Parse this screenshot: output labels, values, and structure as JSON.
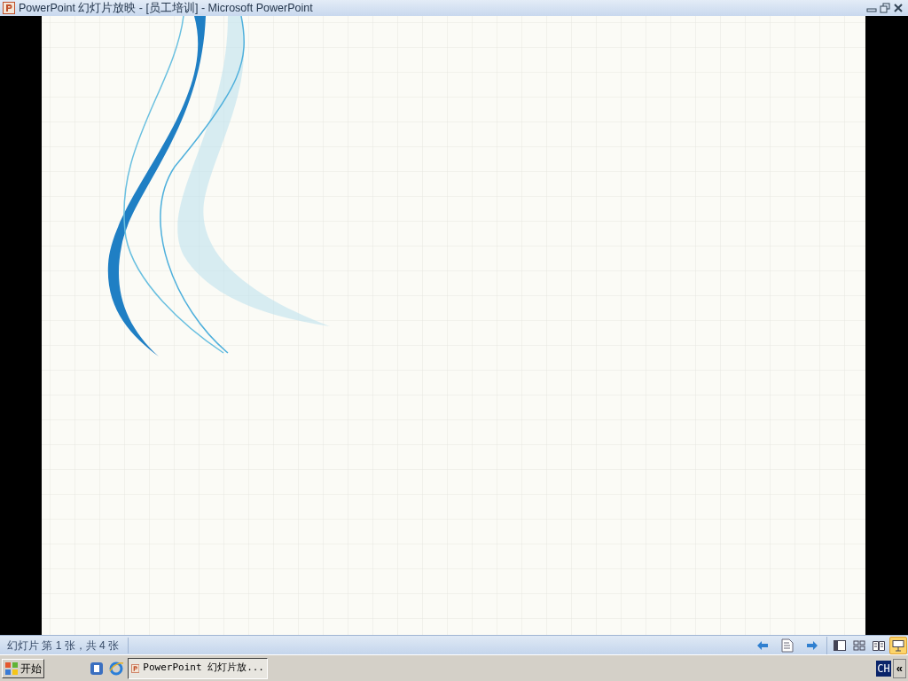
{
  "window": {
    "title": "PowerPoint 幻灯片放映 - [员工培训] - Microsoft PowerPoint"
  },
  "status_bar": {
    "text": "幻灯片 第 1 张，共 4 张",
    "view_buttons": [
      {
        "kind": "normal",
        "selected": false
      },
      {
        "kind": "sorter",
        "selected": false
      },
      {
        "kind": "reading",
        "selected": false
      },
      {
        "kind": "slideshow",
        "selected": true
      }
    ]
  },
  "taskbar": {
    "start": "开始",
    "tasks": [
      {
        "label": "PowerPoint 幻灯片放...",
        "selected": true
      }
    ],
    "tray": {
      "language": "CH",
      "expand": "«"
    }
  }
}
